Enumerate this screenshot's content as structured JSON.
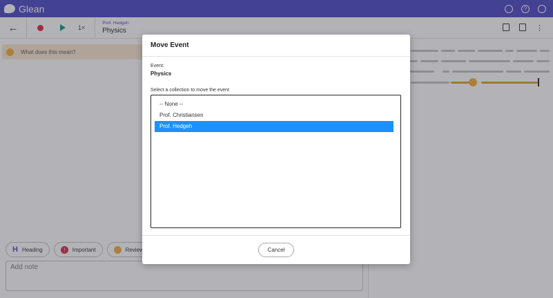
{
  "app": {
    "name": "Glean"
  },
  "toolbar": {
    "speed": "1×",
    "breadcrumb_sub": "Prof. Hedgeh",
    "breadcrumb_title": "Physics"
  },
  "left": {
    "question": "What does this mean?",
    "chips": {
      "heading": "Heading",
      "important": "Important",
      "review": "Review"
    },
    "note_placeholder": "Add note"
  },
  "modal": {
    "title": "Move Event",
    "event_label": "Event:",
    "event_value": "Physics",
    "collection_label": "Select a collection to move the event",
    "options": [
      "-- None --",
      "Prof. Christiansen",
      "Prof. Hedgeh"
    ],
    "selected_option": "Prof. Hedgeh",
    "cancel_label": "Cancel"
  },
  "colors": {
    "brand": "#5b57c8",
    "record": "#e23a56",
    "play": "#1ea58a",
    "selection": "#1e90ff",
    "highlight": "#e0a83c"
  }
}
